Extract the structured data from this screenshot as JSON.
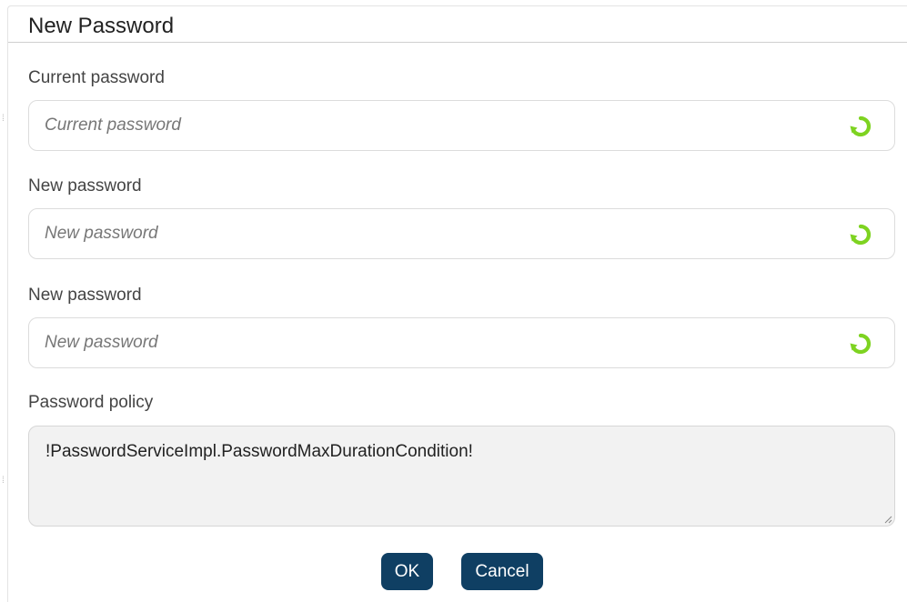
{
  "dialog": {
    "title": "New Password"
  },
  "fields": [
    {
      "label": "Current password",
      "placeholder": "Current password",
      "value": ""
    },
    {
      "label": "New password",
      "placeholder": "New password",
      "value": ""
    },
    {
      "label": "New password",
      "placeholder": "New password",
      "value": ""
    }
  ],
  "policy": {
    "label": "Password policy",
    "text": "!PasswordServiceImpl.PasswordMaxDurationCondition!"
  },
  "buttons": {
    "ok_label": "OK",
    "cancel_label": "Cancel"
  },
  "icons": {
    "field_action": "refresh-icon"
  },
  "colors": {
    "accent_button": "#0f3f63",
    "refresh_icon": "#7ed321",
    "policy_background": "#f2f2f2"
  }
}
